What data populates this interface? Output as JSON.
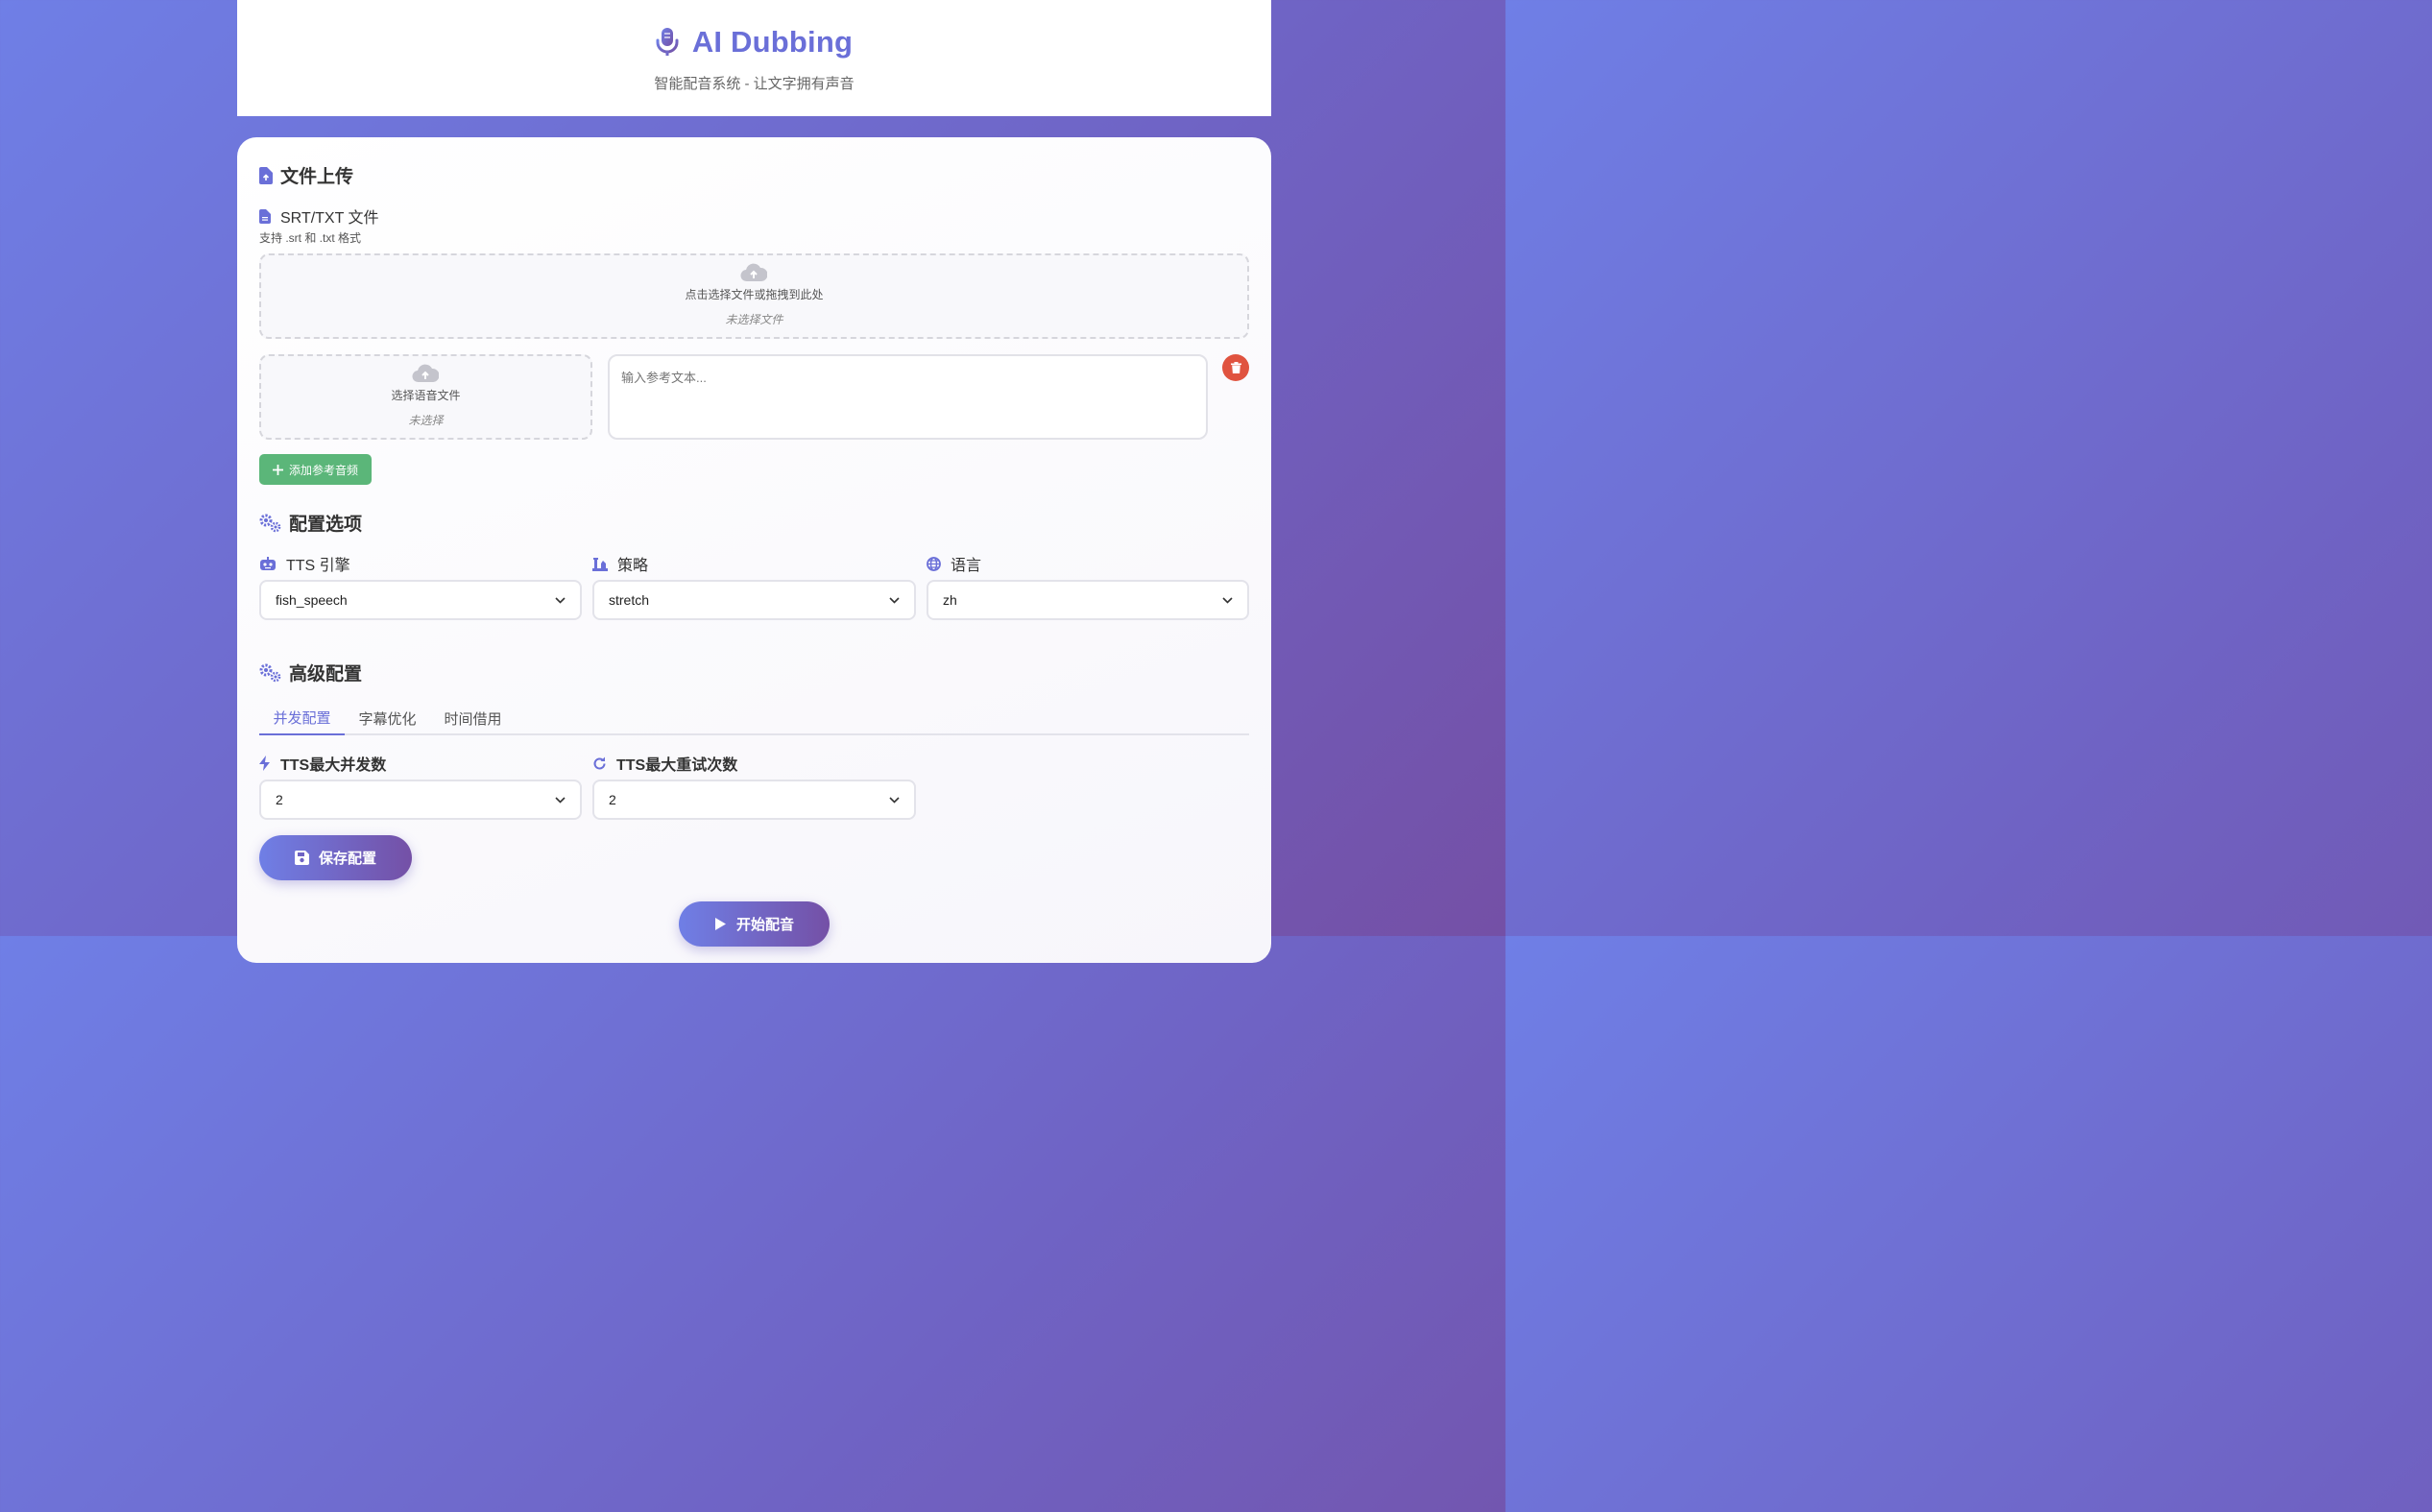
{
  "header": {
    "icon": "microphone-icon",
    "title": "AI Dubbing",
    "subtitle": "智能配音系统 - 让文字拥有声音"
  },
  "upload": {
    "section_title": "文件上传",
    "file_label": "SRT/TXT 文件",
    "file_hint": "支持 .srt 和 .txt 格式",
    "dropzone_text": "点击选择文件或拖拽到此处",
    "dropzone_status": "未选择文件",
    "voice_dropzone_text": "选择语音文件",
    "voice_dropzone_status": "未选择",
    "ref_text_placeholder": "输入参考文本...",
    "add_ref_button": "添加参考音频"
  },
  "config": {
    "section_title": "配置选项",
    "tts_label": "TTS 引擎",
    "tts_value": "fish_speech",
    "strategy_label": "策略",
    "strategy_value": "stretch",
    "language_label": "语言",
    "language_value": "zh"
  },
  "advanced": {
    "section_title": "高级配置",
    "tabs": [
      {
        "label": "并发配置",
        "active": true
      },
      {
        "label": "字幕优化",
        "active": false
      },
      {
        "label": "时间借用",
        "active": false
      }
    ],
    "max_concurrency_label": "TTS最大并发数",
    "max_concurrency_value": "2",
    "max_retry_label": "TTS最大重试次数",
    "max_retry_value": "2",
    "save_button": "保存配置"
  },
  "start_button": "开始配音",
  "colors": {
    "accent": "#6a6fd8",
    "danger": "#e0533f",
    "success": "#5bb679"
  }
}
